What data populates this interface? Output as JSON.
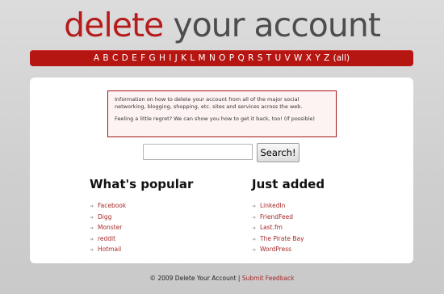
{
  "logo": {
    "part1": "delete",
    "part2": "your account"
  },
  "alphabet": [
    "A",
    "B",
    "C",
    "D",
    "E",
    "F",
    "G",
    "H",
    "I",
    "J",
    "K",
    "L",
    "M",
    "N",
    "O",
    "P",
    "Q",
    "R",
    "S",
    "T",
    "U",
    "V",
    "W",
    "X",
    "Y",
    "Z",
    "(all)"
  ],
  "info": {
    "line1": "Information on how to delete your account from all of the major social networking, blogging, shopping, etc. sites and services across the web.",
    "line2": "Feeling a little regret? We can show you how to get it back, too! (If possible)"
  },
  "search": {
    "value": "",
    "button_label": "Search!"
  },
  "popular": {
    "heading": "What's popular",
    "items": [
      "Facebook",
      "Digg",
      "Monster",
      "reddit",
      "Hotmail"
    ]
  },
  "added": {
    "heading": "Just added",
    "items": [
      "LinkedIn",
      "FriendFeed",
      "Last.fm",
      "The Pirate Bay",
      "WordPress"
    ]
  },
  "footer": {
    "copyright": "© 2009 Delete Your Account",
    "separator": " | ",
    "feedback": "Submit Feedback"
  },
  "icons": {
    "list_bullet": "right-arrow-icon"
  },
  "colors": {
    "brand_red": "#b51612",
    "link": "#a52a2a",
    "logo_gray": "#4d4d4d"
  }
}
